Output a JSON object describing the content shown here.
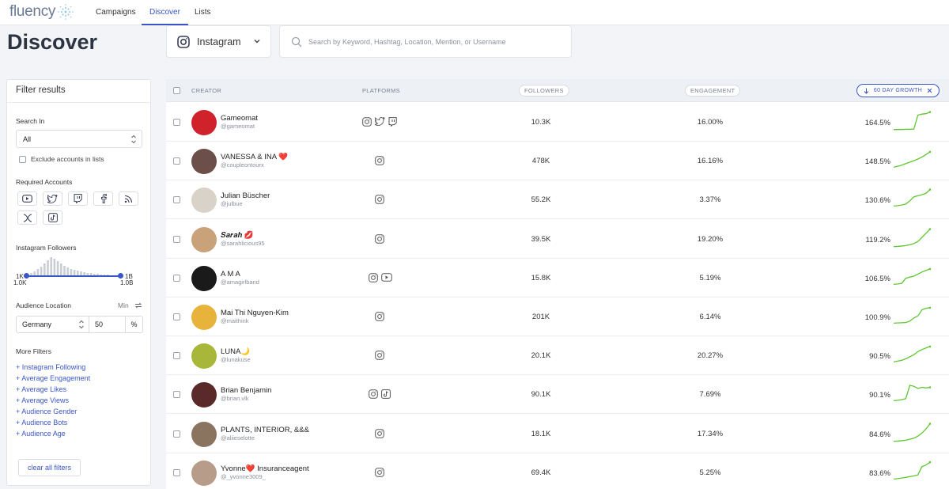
{
  "app": {
    "logo_text": "fluency",
    "brand_color": "#3a56c5",
    "accent_green": "#5ec72f"
  },
  "nav": {
    "tabs": [
      {
        "label": "Campaigns"
      },
      {
        "label": "Discover",
        "active": true
      },
      {
        "label": "Lists"
      }
    ]
  },
  "page": {
    "title": "Discover"
  },
  "platform_select": {
    "value": "Instagram",
    "icon": "instagram-icon"
  },
  "search": {
    "placeholder": "Search by Keyword, Hashtag, Location, Mention, or Username"
  },
  "filters": {
    "title": "Filter results",
    "search_in_label": "Search In",
    "search_in_value": "All",
    "exclude_label": "Exclude accounts in lists",
    "required_accounts_label": "Required Accounts",
    "required_accounts_icons": [
      "youtube-icon",
      "twitter-icon",
      "twitch-icon",
      "facebook-icon",
      "rss-icon",
      "x-icon",
      "tiktok-icon"
    ],
    "followers_label": "Instagram Followers",
    "followers_min_label": "1K",
    "followers_min_value": "1.0K",
    "followers_max_label": "1B",
    "followers_max_value": "1.0B",
    "audience_location_label": "Audience Location",
    "audience_location_min": "Min",
    "audience_location_country": "Germany",
    "audience_location_value": "50",
    "audience_location_unit": "%",
    "more_filters_label": "More Filters",
    "more_filters": [
      "+ Instagram Following",
      "+ Average Engagement",
      "+ Average Likes",
      "+ Average Views",
      "+ Audience Gender",
      "+ Audience Bots",
      "+ Audience Age"
    ],
    "clear_label": "clear all filters"
  },
  "table": {
    "headers": {
      "creator": "CREATOR",
      "platforms": "PLATFORMS",
      "followers": "FOLLOWERS",
      "engagement": "ENGAGEMENT",
      "growth": "60 DAY GROWTH"
    },
    "rows": [
      {
        "name": "Gameomat",
        "handle": "@gameomat",
        "platforms": [
          "instagram-icon",
          "twitter-icon",
          "twitch-icon"
        ],
        "followers": "10.3K",
        "engagement": "16.00%",
        "growth": "164.5%",
        "avatar_color": "#d0222a",
        "trend": [
          0.05,
          0.05,
          0.05,
          0.06,
          0.06,
          0.07,
          0.75,
          0.8,
          0.82,
          0.9
        ]
      },
      {
        "name": "VANESSA & INA ❤️",
        "handle": "@coupleontourx",
        "platforms": [
          "instagram-icon"
        ],
        "followers": "478K",
        "engagement": "16.16%",
        "growth": "148.5%",
        "avatar_color": "#6b4f48",
        "trend": [
          0.1,
          0.15,
          0.2,
          0.28,
          0.35,
          0.42,
          0.5,
          0.6,
          0.72,
          0.85
        ]
      },
      {
        "name": "Julian Büscher",
        "handle": "@julbue",
        "platforms": [
          "instagram-icon"
        ],
        "followers": "55.2K",
        "engagement": "3.37%",
        "growth": "130.6%",
        "avatar_color": "#d9d2c8",
        "trend": [
          0.1,
          0.12,
          0.15,
          0.2,
          0.35,
          0.55,
          0.6,
          0.65,
          0.72,
          0.9
        ]
      },
      {
        "name": "𝑺𝒂𝒓𝒂𝒉 💋",
        "handle": "@sarahlicious95",
        "platforms": [
          "instagram-icon"
        ],
        "followers": "39.5K",
        "engagement": "19.20%",
        "growth": "119.2%",
        "avatar_color": "#c9a27a",
        "trend": [
          0.05,
          0.06,
          0.08,
          0.1,
          0.14,
          0.2,
          0.3,
          0.5,
          0.7,
          0.9
        ]
      },
      {
        "name": "A M A",
        "handle": "@amagirlband",
        "platforms": [
          "instagram-icon",
          "youtube-icon"
        ],
        "followers": "15.8K",
        "engagement": "5.19%",
        "growth": "106.5%",
        "avatar_color": "#1a1a1a",
        "trend": [
          0.1,
          0.12,
          0.15,
          0.4,
          0.45,
          0.5,
          0.6,
          0.7,
          0.78,
          0.85
        ]
      },
      {
        "name": "Mai Thi Nguyen-Kim",
        "handle": "@maithink",
        "platforms": [
          "instagram-icon"
        ],
        "followers": "201K",
        "engagement": "6.14%",
        "growth": "100.9%",
        "avatar_color": "#e8b33a",
        "trend": [
          0.1,
          0.11,
          0.12,
          0.13,
          0.2,
          0.35,
          0.45,
          0.75,
          0.82,
          0.85
        ]
      },
      {
        "name": "LUNA🌙",
        "handle": "@lunakuse",
        "platforms": [
          "instagram-icon"
        ],
        "followers": "20.1K",
        "engagement": "20.27%",
        "growth": "90.5%",
        "avatar_color": "#a8b63a",
        "trend": [
          0.1,
          0.14,
          0.18,
          0.25,
          0.35,
          0.45,
          0.6,
          0.7,
          0.78,
          0.85
        ]
      },
      {
        "name": "Brian Benjamin",
        "handle": "@brian.vlk",
        "platforms": [
          "instagram-icon",
          "tiktok-icon"
        ],
        "followers": "90.1K",
        "engagement": "7.69%",
        "growth": "90.1%",
        "avatar_color": "#5a2a2a",
        "trend": [
          0.1,
          0.12,
          0.15,
          0.2,
          0.85,
          0.8,
          0.7,
          0.75,
          0.72,
          0.75
        ]
      },
      {
        "name": "PLANTS, INTERIOR, &&&",
        "handle": "@aliieselotte",
        "platforms": [
          "instagram-icon"
        ],
        "followers": "18.1K",
        "engagement": "17.34%",
        "growth": "84.6%",
        "avatar_color": "#8a7460",
        "trend": [
          0.05,
          0.06,
          0.08,
          0.1,
          0.15,
          0.2,
          0.3,
          0.45,
          0.65,
          0.9
        ]
      },
      {
        "name": "Yvonne❤️ Insuranceagent",
        "handle": "@_yvonne3009_",
        "platforms": [
          "instagram-icon"
        ],
        "followers": "69.4K",
        "engagement": "5.25%",
        "growth": "83.6%",
        "avatar_color": "#b89c8a",
        "trend": [
          0.1,
          0.12,
          0.15,
          0.18,
          0.22,
          0.25,
          0.3,
          0.7,
          0.78,
          0.92
        ]
      }
    ]
  }
}
